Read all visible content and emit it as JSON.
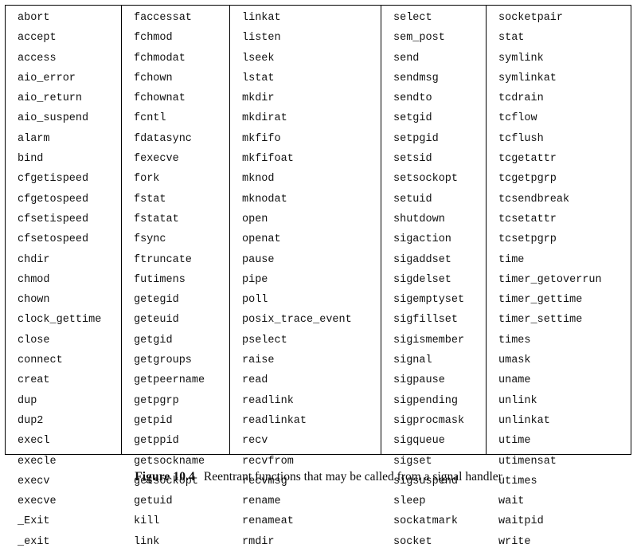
{
  "figure": {
    "caption_label": "Figure 10.4",
    "caption_text": "Reentrant functions that may be called from a signal handler"
  },
  "table": {
    "row_count": 22,
    "column_count": 5,
    "border_color": "#000000",
    "background_color": "#ffffff",
    "text_color": "#111111",
    "columns": [
      [
        "abort",
        "accept",
        "access",
        "aio_error",
        "aio_return",
        "aio_suspend",
        "alarm",
        "bind",
        "cfgetispeed",
        "cfgetospeed",
        "cfsetispeed",
        "cfsetospeed",
        "chdir",
        "chmod",
        "chown",
        "clock_gettime",
        "close",
        "connect",
        "creat",
        "dup",
        "dup2",
        "execl",
        "execle",
        "execv",
        "execve",
        "_Exit",
        "_exit"
      ],
      [
        "faccessat",
        "fchmod",
        "fchmodat",
        "fchown",
        "fchownat",
        "fcntl",
        "fdatasync",
        "fexecve",
        "fork",
        "fstat",
        "fstatat",
        "fsync",
        "ftruncate",
        "futimens",
        "getegid",
        "geteuid",
        "getgid",
        "getgroups",
        "getpeername",
        "getpgrp",
        "getpid",
        "getppid",
        "getsockname",
        "getsockopt",
        "getuid",
        "kill",
        "link"
      ],
      [
        "linkat",
        "listen",
        "lseek",
        "lstat",
        "mkdir",
        "mkdirat",
        "mkfifo",
        "mkfifoat",
        "mknod",
        "mknodat",
        "open",
        "openat",
        "pause",
        "pipe",
        "poll",
        "posix_trace_event",
        "pselect",
        "raise",
        "read",
        "readlink",
        "readlinkat",
        "recv",
        "recvfrom",
        "recvmsg",
        "rename",
        "renameat",
        "rmdir"
      ],
      [
        "select",
        "sem_post",
        "send",
        "sendmsg",
        "sendto",
        "setgid",
        "setpgid",
        "setsid",
        "setsockopt",
        "setuid",
        "shutdown",
        "sigaction",
        "sigaddset",
        "sigdelset",
        "sigemptyset",
        "sigfillset",
        "sigismember",
        "signal",
        "sigpause",
        "sigpending",
        "sigprocmask",
        "sigqueue",
        "sigset",
        "sigsuspend",
        "sleep",
        "sockatmark",
        "socket"
      ],
      [
        "socketpair",
        "stat",
        "symlink",
        "symlinkat",
        "tcdrain",
        "tcflow",
        "tcflush",
        "tcgetattr",
        "tcgetpgrp",
        "tcsendbreak",
        "tcsetattr",
        "tcsetpgrp",
        "time",
        "timer_getoverrun",
        "timer_gettime",
        "timer_settime",
        "times",
        "umask",
        "uname",
        "unlink",
        "unlinkat",
        "utime",
        "utimensat",
        "utimes",
        "wait",
        "waitpid",
        "write"
      ]
    ]
  }
}
